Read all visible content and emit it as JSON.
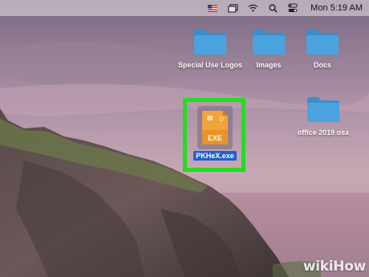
{
  "menubar": {
    "clock": "Mon 5:19 AM",
    "icons": [
      "flag-icon",
      "window-icon",
      "wifi-icon",
      "search-icon",
      "control-center-icon"
    ]
  },
  "desktop": {
    "folders": [
      {
        "label": "Special Use Logos"
      },
      {
        "label": "Images"
      },
      {
        "label": "Docs"
      },
      {
        "label": "office 2019 osx"
      }
    ],
    "selected_file": {
      "label": "PKHeX.exe",
      "badge": "EXE"
    }
  },
  "watermark": {
    "text": "wikiHow"
  },
  "colors": {
    "folder": "#4aa3df",
    "folder_dark": "#3b8fc9",
    "exe_icon": "#f0a43a",
    "selection_frame": "#22dd22",
    "label_highlight": "#1f5fd1"
  }
}
